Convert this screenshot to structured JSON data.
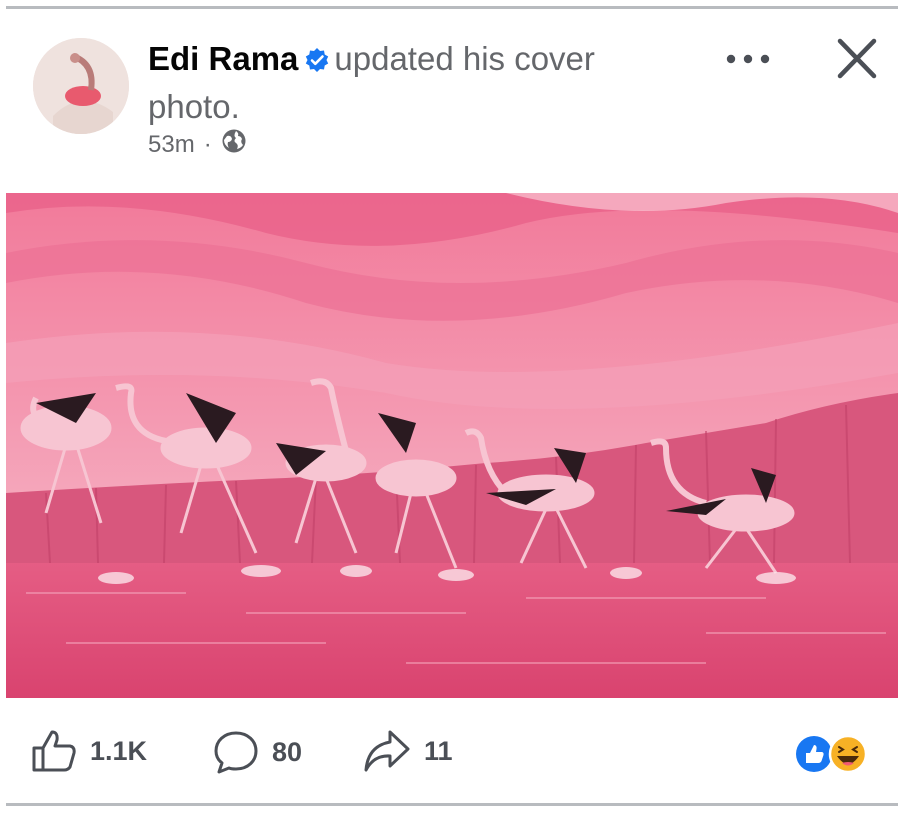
{
  "post": {
    "author": "Edi Rama",
    "action": "updated his cover photo.",
    "time": "53m",
    "separator": "·",
    "privacy_icon": "globe-icon",
    "verified_icon": "verified-badge-icon",
    "menu_icon": "more-horizontal-icon",
    "close_icon": "close-icon"
  },
  "footer": {
    "likes": "1.1K",
    "comments": "80",
    "shares": "11",
    "reaction_icons": [
      "like-reaction-icon",
      "haha-reaction-icon"
    ]
  },
  "colors": {
    "verified_blue": "#1877f2",
    "meta_grey": "#65676b",
    "photo_pink": "#e06a8c"
  }
}
